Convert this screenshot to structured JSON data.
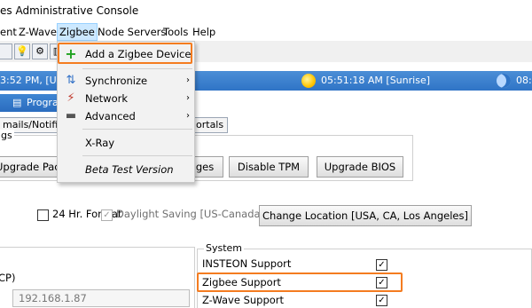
{
  "window": {
    "title": "es Administrative Console"
  },
  "menubar": {
    "items": [
      "ent",
      "Z-Wave",
      "Zigbee",
      "Node Servers",
      "Tools",
      "Help"
    ]
  },
  "statusbar": {
    "time_left": "3:52 PM, [U",
    "sunrise": "05:51:18 AM [Sunrise]",
    "time_right": "08:"
  },
  "bar2": {
    "label": "Program"
  },
  "tabs": {
    "left": "mails/Notifica",
    "right": "ortals"
  },
  "group1": {
    "label": "gs",
    "buttons": [
      "Upgrade Pack",
      "ges",
      "Disable TPM",
      "Upgrade BIOS"
    ]
  },
  "clock": {
    "format24": "24 Hr. Format",
    "dst": "Daylight Saving [US-Canada]",
    "change_location": "Change Location [USA, CA, Los Angeles]"
  },
  "network": {
    "dhcp_label": "CP)",
    "ip": "192.168.1.87"
  },
  "system": {
    "label": "System",
    "items": [
      {
        "label": "INSTEON Support",
        "checked": true
      },
      {
        "label": "Zigbee Support",
        "checked": true
      },
      {
        "label": "Z-Wave Support",
        "checked": true
      }
    ]
  },
  "zigbee_menu": {
    "add_device": "Add a Zigbee Device",
    "synchronize": "Synchronize",
    "network": "Network",
    "advanced": "Advanced",
    "xray": "X-Ray",
    "beta": "Beta Test Version"
  },
  "colors": {
    "highlight": "#f47c20",
    "statusbar": "#2f74c6"
  }
}
